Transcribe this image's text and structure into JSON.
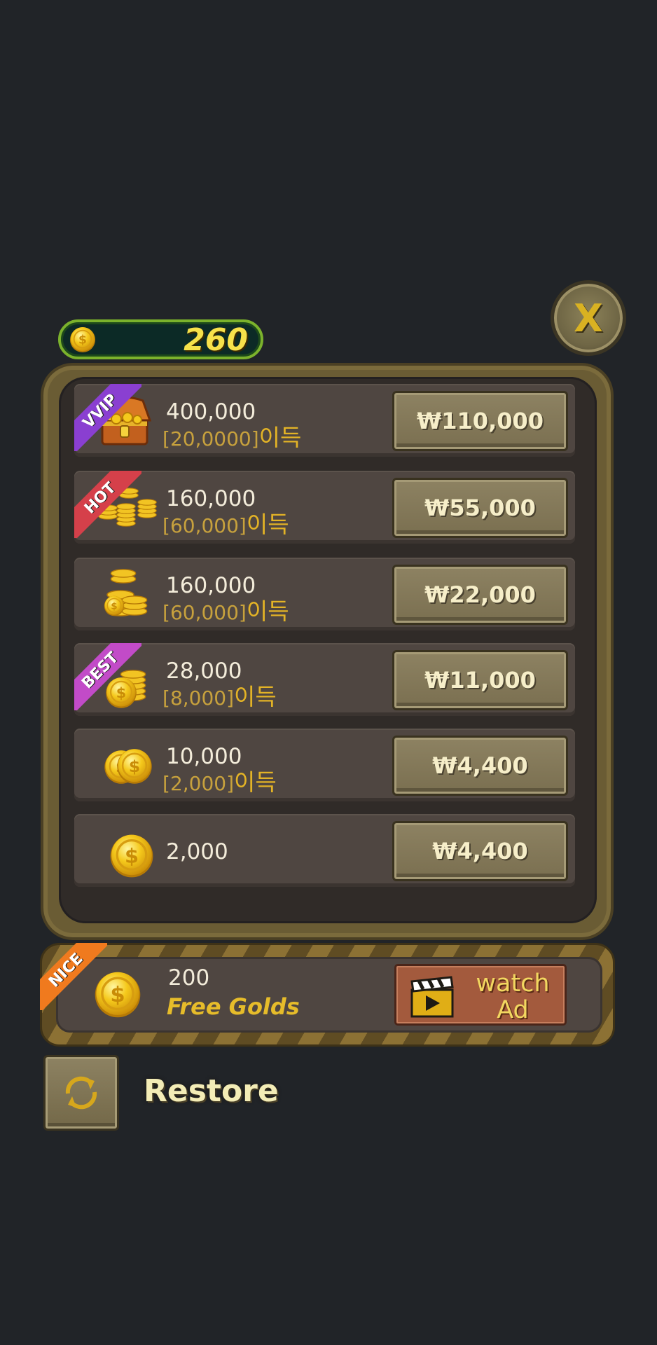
{
  "balance": {
    "coins": "260"
  },
  "close": {
    "label": "X"
  },
  "packages": [
    {
      "badge": "VVIP",
      "badge_color": "#8a3fd1",
      "icon": "treasure-chest-icon",
      "amount": "400,000",
      "bonus": "20,0000",
      "suffix": "이득",
      "price": "₩110,000"
    },
    {
      "badge": "HOT",
      "badge_color": "#d5404a",
      "icon": "coin-stacks-icon",
      "amount": "160,000",
      "bonus": "60,000",
      "suffix": "이득",
      "price": "₩55,000"
    },
    {
      "badge": "",
      "badge_color": "",
      "icon": "coin-pile-icon",
      "amount": "160,000",
      "bonus": "60,000",
      "suffix": "이득",
      "price": "₩22,000"
    },
    {
      "badge": "BEST",
      "badge_color": "#c24bc8",
      "icon": "coin-stack-icon",
      "amount": "28,000",
      "bonus": "8,000",
      "suffix": "이득",
      "price": "₩11,000"
    },
    {
      "badge": "",
      "badge_color": "",
      "icon": "two-coins-icon",
      "amount": "10,000",
      "bonus": "2,000",
      "suffix": "이득",
      "price": "₩4,400"
    },
    {
      "badge": "",
      "badge_color": "",
      "icon": "coin-icon",
      "amount": "2,000",
      "bonus": "",
      "suffix": "",
      "price": "₩4,400"
    }
  ],
  "free_gold": {
    "badge": "NICE",
    "badge_color": "#f07a1e",
    "amount": "200",
    "label": "Free Golds",
    "watch_line1": "watch",
    "watch_line2": "Ad"
  },
  "restore": {
    "label": "Restore"
  }
}
